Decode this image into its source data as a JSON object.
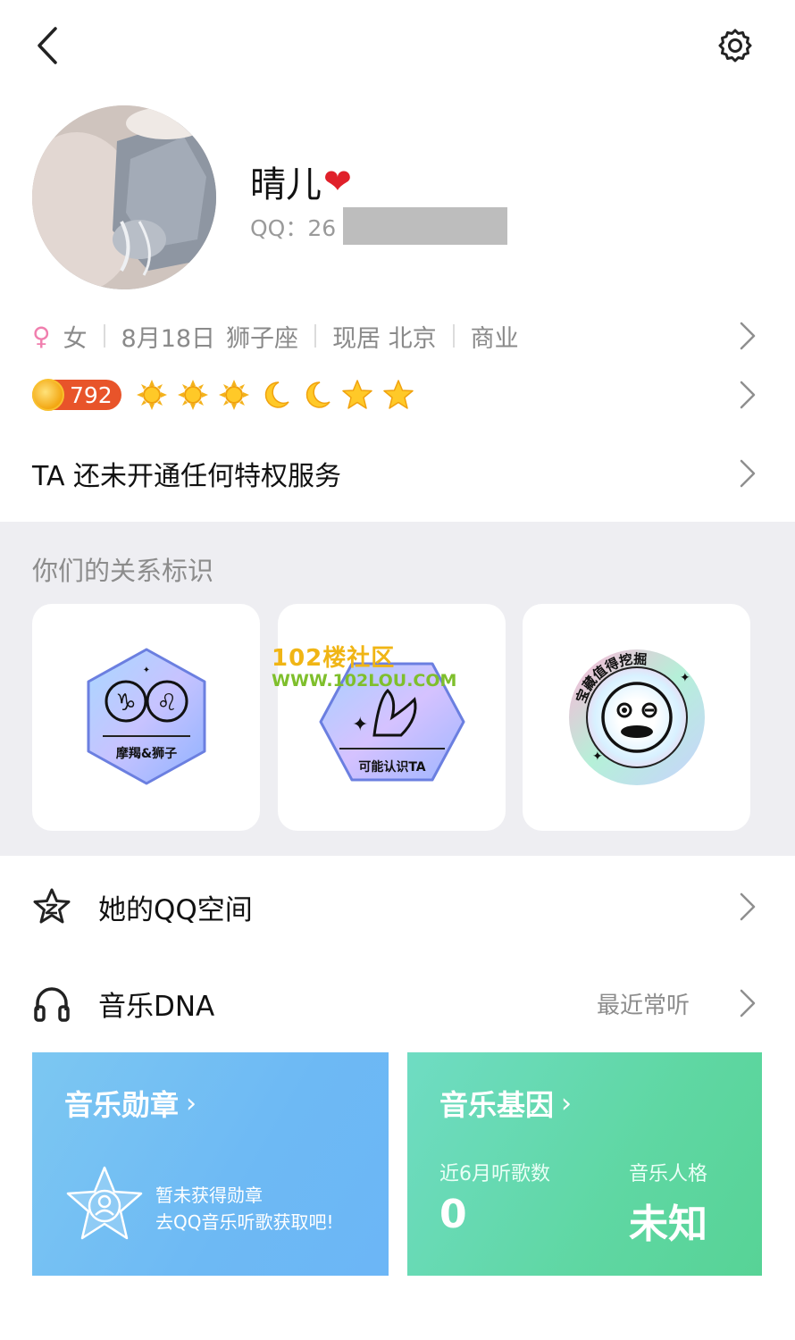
{
  "header": {
    "back_icon": "chevron-left-icon",
    "settings_icon": "gear-icon"
  },
  "profile": {
    "nickname": "晴儿",
    "nickname_emoji": "❤",
    "qq_prefix": "QQ：26"
  },
  "info": {
    "gender": "女",
    "birthday": "8月18日",
    "zodiac": "狮子座",
    "location": "现居 北京",
    "industry": "商业"
  },
  "level": {
    "value": "792",
    "icons": [
      "sun",
      "sun",
      "sun",
      "moon",
      "moon",
      "star",
      "star"
    ]
  },
  "privilege": {
    "text": "TA 还未开通任何特权服务"
  },
  "relations": {
    "title": "你们的关系标识",
    "cards": [
      {
        "label": "摩羯&狮子"
      },
      {
        "label": "可能认识TA"
      },
      {
        "label": "宝藏值得挖掘"
      }
    ]
  },
  "watermark": {
    "line1": "102楼社区",
    "line2": "WWW.102LOU.COM"
  },
  "qzone": {
    "label": "她的QQ空间"
  },
  "music": {
    "label": "音乐DNA",
    "recent": "最近常听",
    "medal_card": {
      "title": "音乐勋章",
      "line1": "暂未获得勋章",
      "line2": "去QQ音乐听歌获取吧!"
    },
    "gene_card": {
      "title": "音乐基因",
      "songs_label": "近6月听歌数",
      "songs_value": "0",
      "persona_label": "音乐人格",
      "persona_value": "未知"
    }
  },
  "colors": {
    "accent_female": "#f07fae",
    "level_bg": "#e8542a",
    "section_bg": "#eeeef2",
    "medal_card": "#6db9f4",
    "gene_card": "#5fd7a3"
  }
}
